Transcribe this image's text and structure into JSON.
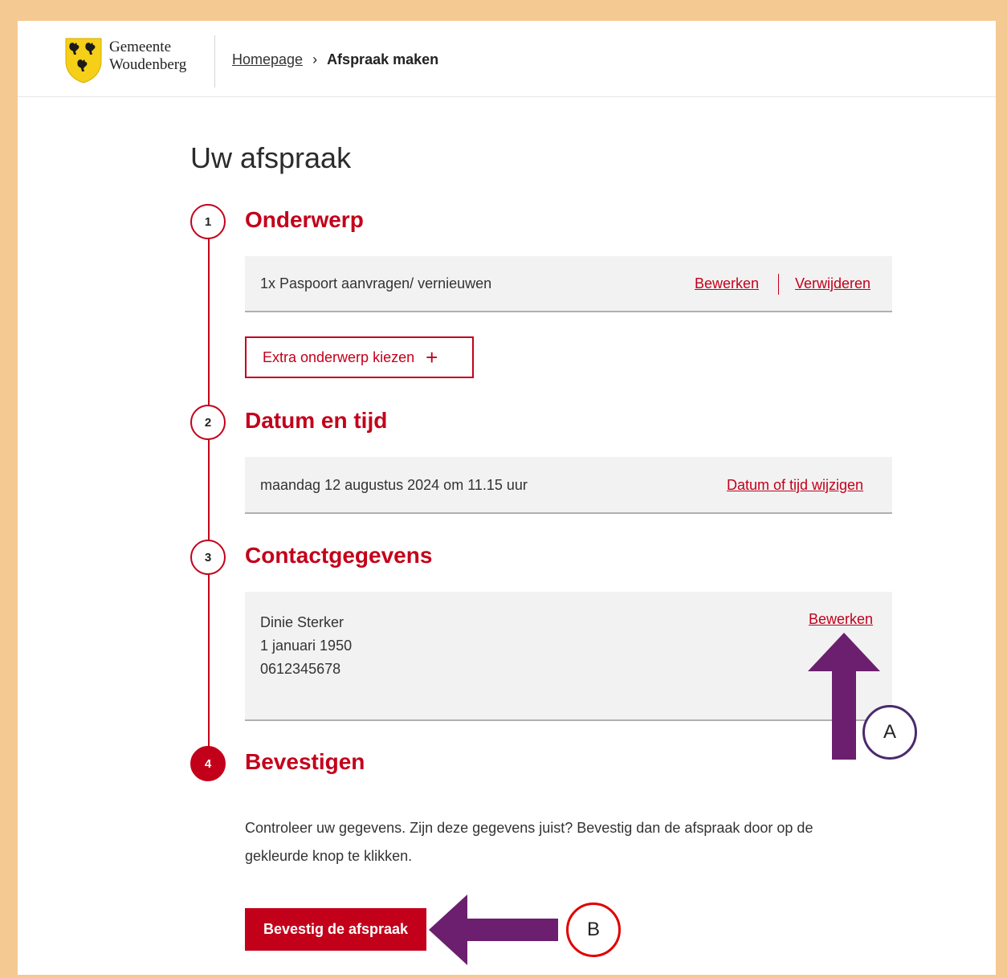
{
  "header": {
    "logo_line1": "Gemeente",
    "logo_line2": "Woudenberg",
    "breadcrumb": {
      "home": "Homepage",
      "separator": "›",
      "current": "Afspraak maken"
    }
  },
  "page": {
    "title": "Uw afspraak"
  },
  "steps": [
    {
      "number": "1",
      "title": "Onderwerp"
    },
    {
      "number": "2",
      "title": "Datum en tijd"
    },
    {
      "number": "3",
      "title": "Contactgegevens"
    },
    {
      "number": "4",
      "title": "Bevestigen"
    }
  ],
  "onderwerp": {
    "item": "1x Paspoort aanvragen/ vernieuwen",
    "edit_label": "Bewerken",
    "delete_label": "Verwijderen",
    "extra_button": "Extra onderwerp kiezen",
    "extra_icon": "plus-icon"
  },
  "datum": {
    "value": "maandag 12 augustus 2024 om 11.15 uur",
    "change_label": "Datum of tijd wijzigen"
  },
  "contact": {
    "name": "Dinie Sterker",
    "birthdate": "1 januari 1950",
    "phone": "0612345678",
    "edit_label": "Bewerken"
  },
  "bevestigen": {
    "instruction": "Controleer uw gegevens. Zijn deze gegevens juist? Bevestig dan de afspraak door op de gekleurde knop te klikken.",
    "button_label": "Bevestig de afspraak"
  },
  "annotations": {
    "marker_a": "A",
    "marker_b": "B"
  },
  "colors": {
    "accent": "#c3001a",
    "frame_background": "#f5c992",
    "annotation_arrow": "#6b1f6e",
    "marker_a_border": "#4b2a6e",
    "marker_b_border": "#e00000"
  }
}
